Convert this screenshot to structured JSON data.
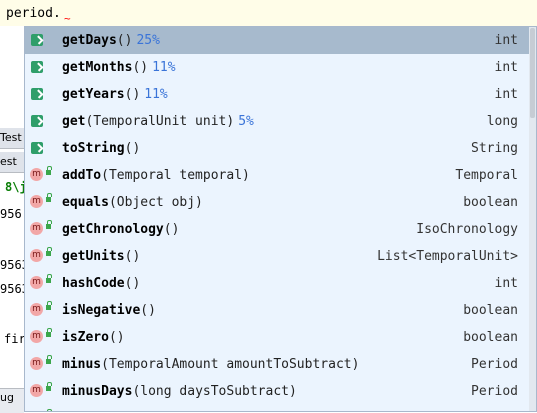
{
  "editor": {
    "line_text": "period.",
    "error_mark": "~"
  },
  "background": {
    "tab1": "Test",
    "tab2": "est",
    "frag1": "8\\j",
    "frag2": "956",
    "frag3": "9563",
    "frag4": "9563",
    "frag5": "fir",
    "bottom_tab": "ug"
  },
  "completion": {
    "items": [
      {
        "name": "getDays",
        "params": "()",
        "hint": "25%",
        "return_type": "int",
        "kind": "static-method",
        "selected": true
      },
      {
        "name": "getMonths",
        "params": "()",
        "hint": "11%",
        "return_type": "int",
        "kind": "static-method"
      },
      {
        "name": "getYears",
        "params": "()",
        "hint": "11%",
        "return_type": "int",
        "kind": "static-method"
      },
      {
        "name": "get",
        "params": "(TemporalUnit unit)",
        "hint": "5%",
        "return_type": "long",
        "kind": "static-method"
      },
      {
        "name": "toString",
        "params": "()",
        "hint": "",
        "return_type": "String",
        "kind": "static-method"
      },
      {
        "name": "addTo",
        "params": "(Temporal temporal)",
        "hint": "",
        "return_type": "Temporal",
        "kind": "method"
      },
      {
        "name": "equals",
        "params": "(Object obj)",
        "hint": "",
        "return_type": "boolean",
        "kind": "method"
      },
      {
        "name": "getChronology",
        "params": "()",
        "hint": "",
        "return_type": "IsoChronology",
        "kind": "method"
      },
      {
        "name": "getUnits",
        "params": "()",
        "hint": "",
        "return_type": "List<TemporalUnit>",
        "kind": "method"
      },
      {
        "name": "hashCode",
        "params": "()",
        "hint": "",
        "return_type": "int",
        "kind": "method"
      },
      {
        "name": "isNegative",
        "params": "()",
        "hint": "",
        "return_type": "boolean",
        "kind": "method"
      },
      {
        "name": "isZero",
        "params": "()",
        "hint": "",
        "return_type": "boolean",
        "kind": "method"
      },
      {
        "name": "minus",
        "params": "(TemporalAmount amountToSubtract)",
        "hint": "",
        "return_type": "Period",
        "kind": "method"
      },
      {
        "name": "minusDays",
        "params": "(long daysToSubtract)",
        "hint": "",
        "return_type": "Period",
        "kind": "method"
      },
      {
        "name": "",
        "params": "",
        "hint": "",
        "return_type": "",
        "kind": "method"
      }
    ],
    "icon_letter": "m"
  },
  "colors": {
    "selected_bg": "#a7bacd",
    "popup_bg": "#ebf4fe",
    "hint": "#3a74d8"
  }
}
